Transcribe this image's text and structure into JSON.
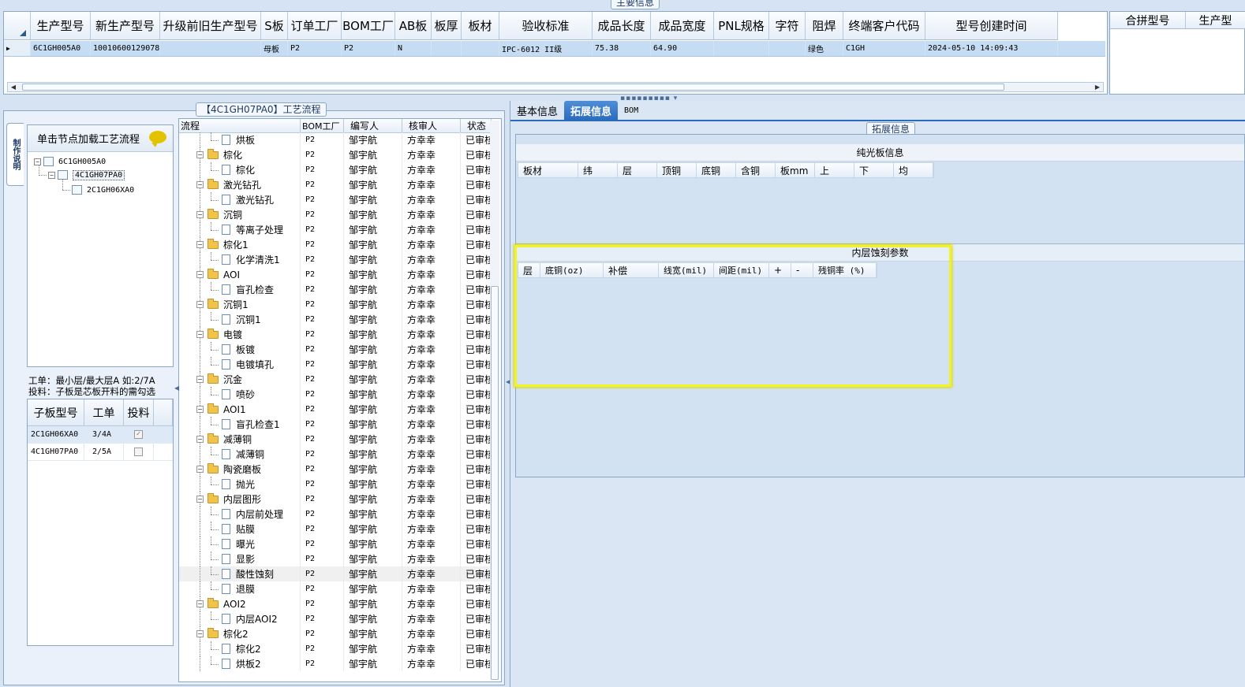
{
  "top": {
    "group_title": "主要信息",
    "columns": [
      "生产型号",
      "新生产型号",
      "升级前旧生产型号",
      "S板",
      "订单工厂",
      "BOM工厂",
      "AB板",
      "板厚",
      "板材",
      "验收标准",
      "成品长度",
      "成品宽度",
      "PNL规格",
      "字符",
      "阻焊",
      "终端客户代码",
      "型号创建时间"
    ],
    "row": [
      "6C1GH005A0",
      "10010600129078",
      "",
      "母板",
      "P2",
      "P2",
      "N",
      "",
      "",
      "IPC-6012 II级",
      "75.38",
      "64.90",
      "",
      "",
      "绿色",
      "C1GH",
      "2024-05-10 14:09:43"
    ],
    "right_columns": [
      "合拼型号",
      "生产型"
    ]
  },
  "left": {
    "group_title": "【4C1GH07PA0】工艺流程",
    "side_tab": "制作说明",
    "load_header": "单击节点加载工艺流程",
    "tree": [
      "6C1GH005A0",
      "4C1GH07PA0",
      "2C1GH06XA0"
    ],
    "note_line1": "工单：最小层/最大层A 如:2/7A",
    "note_line2": "投料：子板是芯板开料的需勾选",
    "sub_columns": [
      "子板型号",
      "工单",
      "投料"
    ],
    "sub_rows": [
      {
        "model": "2C1GH06XA0",
        "order": "3/4A",
        "checked": "✓"
      },
      {
        "model": "4C1GH07PA0",
        "order": "2/5A",
        "checked": ""
      }
    ]
  },
  "flow": {
    "columns": [
      "流程",
      "BOM工厂",
      "编写人",
      "核审人",
      "状态"
    ],
    "rows": [
      {
        "type": "child",
        "name": "烘板",
        "bom": "P2",
        "writer": "邹宇航",
        "reviewer": "方幸幸",
        "status": "已审核"
      },
      {
        "type": "folder",
        "name": "棕化",
        "bom": "P2",
        "writer": "邹宇航",
        "reviewer": "方幸幸",
        "status": "已审核"
      },
      {
        "type": "child",
        "name": "棕化",
        "bom": "P2",
        "writer": "邹宇航",
        "reviewer": "方幸幸",
        "status": "已审核"
      },
      {
        "type": "folder",
        "name": "激光钻孔",
        "bom": "P2",
        "writer": "邹宇航",
        "reviewer": "方幸幸",
        "status": "已审核"
      },
      {
        "type": "child",
        "name": "激光钻孔",
        "bom": "P2",
        "writer": "邹宇航",
        "reviewer": "方幸幸",
        "status": "已审核"
      },
      {
        "type": "folder",
        "name": "沉铜",
        "bom": "P2",
        "writer": "邹宇航",
        "reviewer": "方幸幸",
        "status": "已审核"
      },
      {
        "type": "child",
        "name": "等离子处理",
        "bom": "P2",
        "writer": "邹宇航",
        "reviewer": "方幸幸",
        "status": "已审核"
      },
      {
        "type": "folder",
        "name": "棕化1",
        "bom": "P2",
        "writer": "邹宇航",
        "reviewer": "方幸幸",
        "status": "已审核"
      },
      {
        "type": "child",
        "name": "化学清洗1",
        "bom": "P2",
        "writer": "邹宇航",
        "reviewer": "方幸幸",
        "status": "已审核"
      },
      {
        "type": "folder",
        "name": "AOI",
        "bom": "P2",
        "writer": "邹宇航",
        "reviewer": "方幸幸",
        "status": "已审核"
      },
      {
        "type": "child",
        "name": "盲孔检查",
        "bom": "P2",
        "writer": "邹宇航",
        "reviewer": "方幸幸",
        "status": "已审核"
      },
      {
        "type": "folder",
        "name": "沉铜1",
        "bom": "P2",
        "writer": "邹宇航",
        "reviewer": "方幸幸",
        "status": "已审核"
      },
      {
        "type": "child",
        "name": "沉铜1",
        "bom": "P2",
        "writer": "邹宇航",
        "reviewer": "方幸幸",
        "status": "已审核"
      },
      {
        "type": "folder",
        "name": "电镀",
        "bom": "P2",
        "writer": "邹宇航",
        "reviewer": "方幸幸",
        "status": "已审核"
      },
      {
        "type": "child",
        "name": "板镀",
        "bom": "P2",
        "writer": "邹宇航",
        "reviewer": "方幸幸",
        "status": "已审核"
      },
      {
        "type": "child",
        "name": "电镀填孔",
        "bom": "P2",
        "writer": "邹宇航",
        "reviewer": "方幸幸",
        "status": "已审核"
      },
      {
        "type": "folder",
        "name": "沉金",
        "bom": "P2",
        "writer": "邹宇航",
        "reviewer": "方幸幸",
        "status": "已审核"
      },
      {
        "type": "child",
        "name": "喷砂",
        "bom": "P2",
        "writer": "邹宇航",
        "reviewer": "方幸幸",
        "status": "已审核"
      },
      {
        "type": "folder",
        "name": "AOI1",
        "bom": "P2",
        "writer": "邹宇航",
        "reviewer": "方幸幸",
        "status": "已审核"
      },
      {
        "type": "child",
        "name": "盲孔检查1",
        "bom": "P2",
        "writer": "邹宇航",
        "reviewer": "方幸幸",
        "status": "已审核"
      },
      {
        "type": "folder",
        "name": "减薄铜",
        "bom": "P2",
        "writer": "邹宇航",
        "reviewer": "方幸幸",
        "status": "已审核"
      },
      {
        "type": "child",
        "name": "减薄铜",
        "bom": "P2",
        "writer": "邹宇航",
        "reviewer": "方幸幸",
        "status": "已审核"
      },
      {
        "type": "folder",
        "name": "陶瓷磨板",
        "bom": "P2",
        "writer": "邹宇航",
        "reviewer": "方幸幸",
        "status": "已审核"
      },
      {
        "type": "child",
        "name": "抛光",
        "bom": "P2",
        "writer": "邹宇航",
        "reviewer": "方幸幸",
        "status": "已审核"
      },
      {
        "type": "folder",
        "name": "内层图形",
        "bom": "P2",
        "writer": "邹宇航",
        "reviewer": "方幸幸",
        "status": "已审核"
      },
      {
        "type": "child",
        "name": "内层前处理",
        "bom": "P2",
        "writer": "邹宇航",
        "reviewer": "方幸幸",
        "status": "已审核"
      },
      {
        "type": "child",
        "name": "贴膜",
        "bom": "P2",
        "writer": "邹宇航",
        "reviewer": "方幸幸",
        "status": "已审核"
      },
      {
        "type": "child",
        "name": "曝光",
        "bom": "P2",
        "writer": "邹宇航",
        "reviewer": "方幸幸",
        "status": "已审核"
      },
      {
        "type": "child",
        "name": "显影",
        "bom": "P2",
        "writer": "邹宇航",
        "reviewer": "方幸幸",
        "status": "已审核"
      },
      {
        "type": "child",
        "name": "酸性蚀刻",
        "bom": "P2",
        "writer": "邹宇航",
        "reviewer": "方幸幸",
        "status": "已审核",
        "hl": true
      },
      {
        "type": "child",
        "name": "退膜",
        "bom": "P2",
        "writer": "邹宇航",
        "reviewer": "方幸幸",
        "status": "已审核"
      },
      {
        "type": "folder",
        "name": "AOI2",
        "bom": "P2",
        "writer": "邹宇航",
        "reviewer": "方幸幸",
        "status": "已审核"
      },
      {
        "type": "child",
        "name": "内层AOI2",
        "bom": "P2",
        "writer": "邹宇航",
        "reviewer": "方幸幸",
        "status": "已审核"
      },
      {
        "type": "folder",
        "name": "棕化2",
        "bom": "P2",
        "writer": "邹宇航",
        "reviewer": "方幸幸",
        "status": "已审核"
      },
      {
        "type": "child",
        "name": "棕化2",
        "bom": "P2",
        "writer": "邹宇航",
        "reviewer": "方幸幸",
        "status": "已审核"
      },
      {
        "type": "child",
        "name": "烘板2",
        "bom": "P2",
        "writer": "邹宇航",
        "reviewer": "方幸幸",
        "status": "已审核"
      }
    ]
  },
  "right": {
    "tabs": [
      "基本信息",
      "拓展信息",
      "BOM"
    ],
    "active_tab": 1,
    "ext_title": "拓展信息",
    "section1_title": "纯光板信息",
    "section1_columns": [
      "板材",
      "纬",
      "层",
      "顶铜",
      "底铜",
      "含铜",
      "板mm",
      "上",
      "下",
      "均"
    ],
    "section2_title": "内层蚀刻参数",
    "section2_columns": [
      "层",
      "底铜(oz)",
      "补偿",
      "线宽(mil)",
      "间距(mil)",
      "+",
      "-",
      "残铜率 (%)"
    ],
    "highlight_color": "#f2f22a"
  }
}
